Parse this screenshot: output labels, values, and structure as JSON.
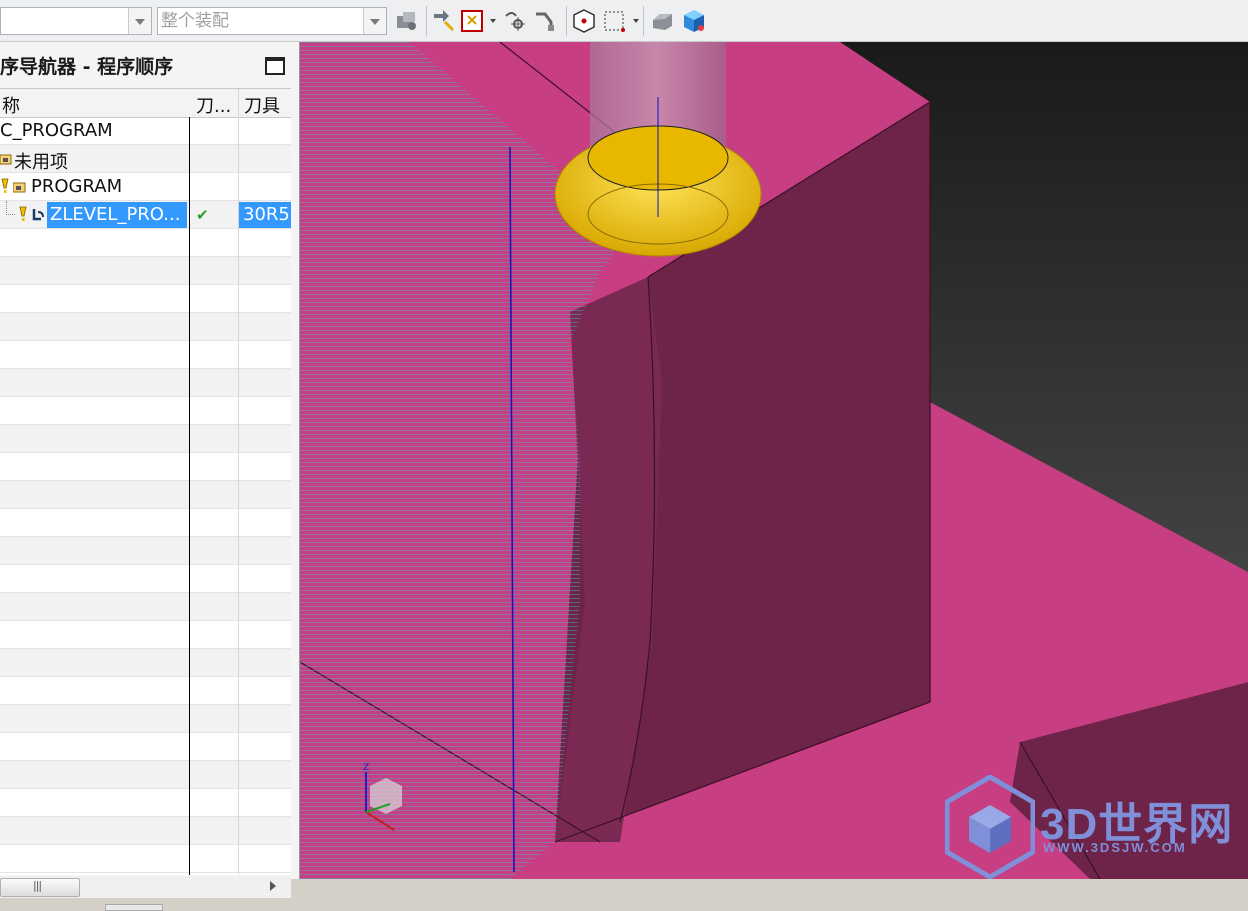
{
  "toolbar": {
    "filter_combo_value": "",
    "assembly_combo_value": "整个装配"
  },
  "navigator": {
    "title": "序导航器 - 程序顺序",
    "columns": [
      "称",
      "刀...",
      "刀具"
    ],
    "rows": [
      {
        "name": "C_PROGRAM",
        "status": "",
        "tool": ""
      },
      {
        "name": "未用项",
        "status": "",
        "tool": ""
      },
      {
        "name": "PROGRAM",
        "status": "",
        "tool": ""
      },
      {
        "name": "ZLEVEL_PRO...",
        "status": "✔",
        "tool": "30R5"
      }
    ]
  },
  "watermark": {
    "text": "3D世界网",
    "url": "WWW.3DSJW.COM"
  },
  "colors": {
    "part_face": "#c73e82",
    "part_dark": "#6e2448",
    "toolpath": "#2ec8d8",
    "tool_holder": "#f0c000",
    "selection": "#3399ff"
  }
}
